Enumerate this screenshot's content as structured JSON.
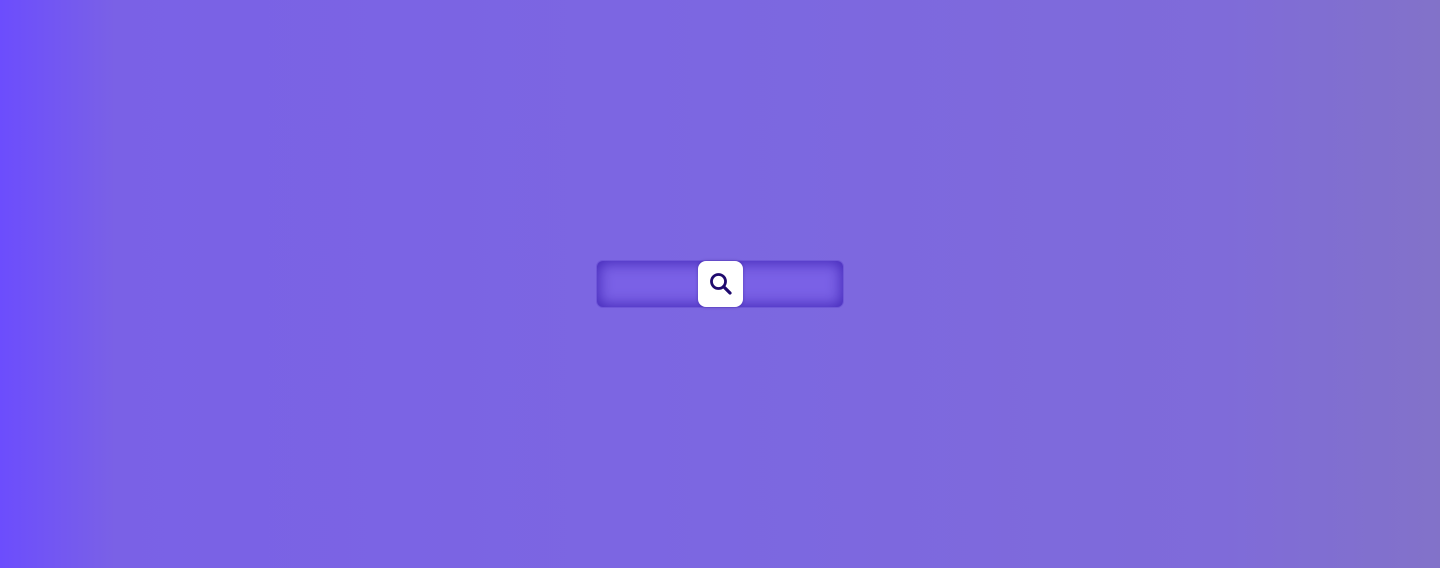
{
  "background": {
    "gradient_start": "#6c4dfd",
    "gradient_end": "#8272c9"
  },
  "search": {
    "value": "",
    "placeholder": "",
    "icon": "search-icon",
    "bar_color": "#7a61e6",
    "button_color": "#ffffff",
    "icon_color": "#1f0a6e"
  }
}
